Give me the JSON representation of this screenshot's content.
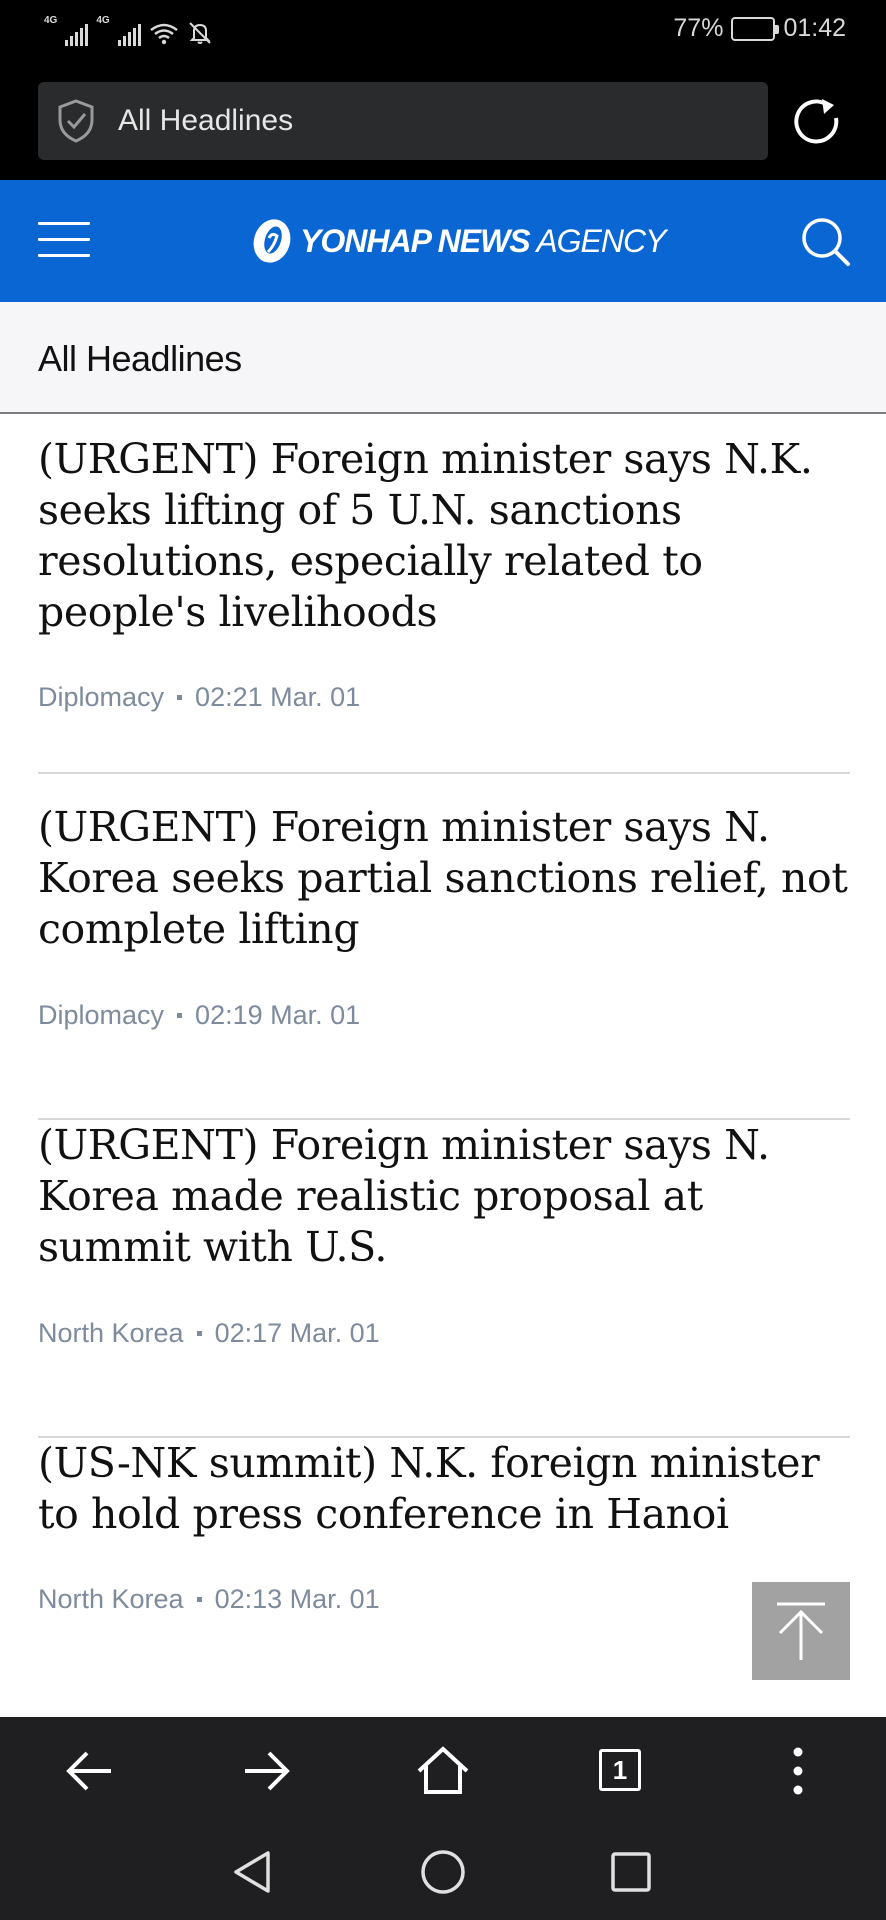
{
  "status_bar": {
    "network_1": "4G",
    "network_2": "4G",
    "battery_percent_label": "77%",
    "battery_level": 0.77,
    "time": "01:42",
    "icons": [
      "signal-icon",
      "signal-icon",
      "wifi-icon",
      "bell-muted-icon",
      "battery-icon"
    ]
  },
  "browser": {
    "url_text": "All Headlines",
    "shield_icon": "shield-check-icon",
    "reload_icon": "reload-icon"
  },
  "site_header": {
    "logo_bold": "YONHAP NEWS",
    "logo_light": "AGENCY",
    "menu_icon": "hamburger-icon",
    "search_icon": "search-icon",
    "brand_color": "#0a66d3"
  },
  "section": {
    "title": "All Headlines"
  },
  "articles": [
    {
      "title": "(URGENT) Foreign minister says N.K. seeks lifting of 5 U.N. sanctions resolutions, especially related to people's livelihoods",
      "category": "Diplomacy",
      "time": "02:21 Mar. 01"
    },
    {
      "title": "(URGENT) Foreign minister says N. Korea seeks partial sanctions relief, not complete lifting",
      "category": "Diplomacy",
      "time": "02:19 Mar. 01"
    },
    {
      "title": "(URGENT) Foreign minister says N. Korea made realistic proposal at summit with U.S.",
      "category": "North Korea",
      "time": "02:17 Mar. 01"
    },
    {
      "title": "(US-NK summit) N.K. foreign minister to hold press conference in Hanoi",
      "category": "North Korea",
      "time": "02:13 Mar. 01"
    }
  ],
  "toolbar": {
    "back_icon": "arrow-left-icon",
    "forward_icon": "arrow-right-icon",
    "home_icon": "home-icon",
    "tab_count": "1",
    "more_icon": "more-vertical-icon"
  },
  "scroll_top_icon": "arrow-up-icon",
  "system_nav": [
    "back-triangle-icon",
    "home-circle-icon",
    "recents-square-icon"
  ]
}
